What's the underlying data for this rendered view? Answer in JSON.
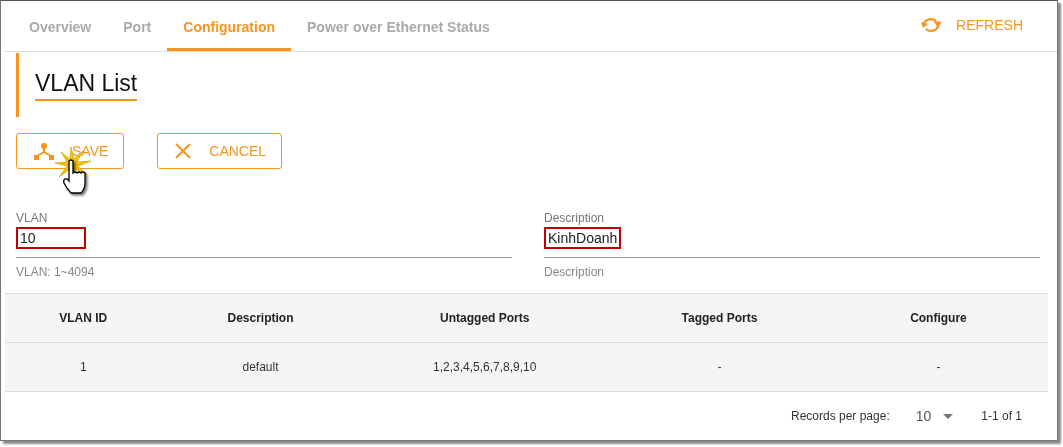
{
  "tabs": [
    {
      "label": "Overview",
      "selected": false
    },
    {
      "label": "Port",
      "selected": false
    },
    {
      "label": "Configuration",
      "selected": true
    },
    {
      "label": "Power over Ethernet Status",
      "selected": false
    }
  ],
  "refresh": {
    "label": "REFRESH"
  },
  "heading": "VLAN List",
  "buttons": [
    {
      "label": "SAVE",
      "kind": "save"
    },
    {
      "label": "CANCEL",
      "kind": "cancel"
    }
  ],
  "fields": [
    {
      "label": "VLAN",
      "value": "10",
      "hint": "VLAN: 1~4094",
      "highlighted": true
    },
    {
      "label": "Description",
      "value": "KinhDoanh",
      "hint": "Description",
      "highlighted": true
    }
  ],
  "table": {
    "columns": [
      "VLAN ID",
      "Description",
      "Untagged Ports",
      "Tagged Ports",
      "Configure"
    ],
    "rows": [
      [
        "1",
        "default",
        "1,2,3,4,5,6,7,8,9,10",
        "-",
        "-"
      ]
    ]
  },
  "pagination": {
    "label": "Records per page:",
    "per_page": "10",
    "range": "1-1 of 1"
  }
}
